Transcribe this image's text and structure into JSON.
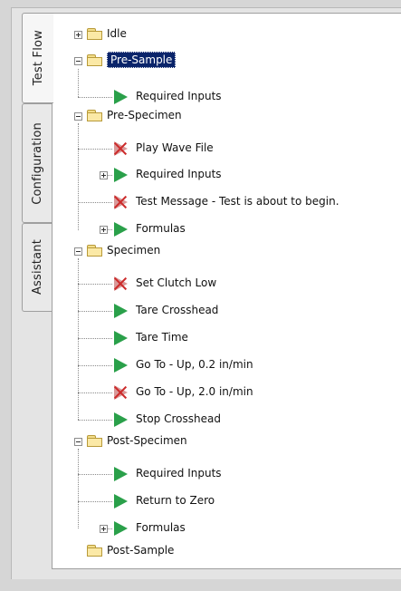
{
  "tabs": [
    {
      "label": "Test Flow",
      "active": true
    },
    {
      "label": "Configuration",
      "active": false
    },
    {
      "label": "Assistant",
      "active": false
    }
  ],
  "tree": {
    "idle": {
      "label": "Idle",
      "icon": "folder-icon",
      "toggle": "plus"
    },
    "pre_sample": {
      "label": "Pre-Sample",
      "icon": "folder-icon",
      "toggle": "minus",
      "selected": true
    },
    "pre_sample_children": [
      {
        "label": "Required Inputs",
        "icon": "play-icon"
      }
    ],
    "pre_specimen": {
      "label": "Pre-Specimen",
      "icon": "folder-icon",
      "toggle": "minus"
    },
    "pre_specimen_children": [
      {
        "label": "Play Wave File",
        "icon": "disabled-play-icon"
      },
      {
        "label": "Required Inputs",
        "icon": "play-icon",
        "toggle": "plus"
      },
      {
        "label": "Test Message - Test is about to begin.",
        "icon": "disabled-play-icon"
      },
      {
        "label": "Formulas",
        "icon": "play-icon",
        "toggle": "plus"
      }
    ],
    "specimen": {
      "label": "Specimen",
      "icon": "folder-icon",
      "toggle": "minus"
    },
    "specimen_children": [
      {
        "label": "Set Clutch Low",
        "icon": "disabled-play-icon"
      },
      {
        "label": "Tare Crosshead",
        "icon": "play-icon"
      },
      {
        "label": "Tare Time",
        "icon": "play-icon"
      },
      {
        "label": "Go To - Up, 0.2 in/min",
        "icon": "play-icon"
      },
      {
        "label": "Go To - Up, 2.0 in/min",
        "icon": "disabled-play-icon"
      },
      {
        "label": "Stop Crosshead",
        "icon": "play-icon"
      }
    ],
    "post_specimen": {
      "label": "Post-Specimen",
      "icon": "folder-icon",
      "toggle": "minus"
    },
    "post_specimen_children": [
      {
        "label": "Required Inputs",
        "icon": "play-icon"
      },
      {
        "label": "Return to Zero",
        "icon": "play-icon"
      },
      {
        "label": "Formulas",
        "icon": "play-icon",
        "toggle": "plus"
      }
    ],
    "post_sample": {
      "label": "Post-Sample",
      "icon": "folder-icon"
    }
  },
  "colors": {
    "selection": "#0a246a",
    "play_green": "#2aa04a",
    "disabled_red": "#cc2b2b",
    "folder_yellow": "#fbe9a6"
  }
}
